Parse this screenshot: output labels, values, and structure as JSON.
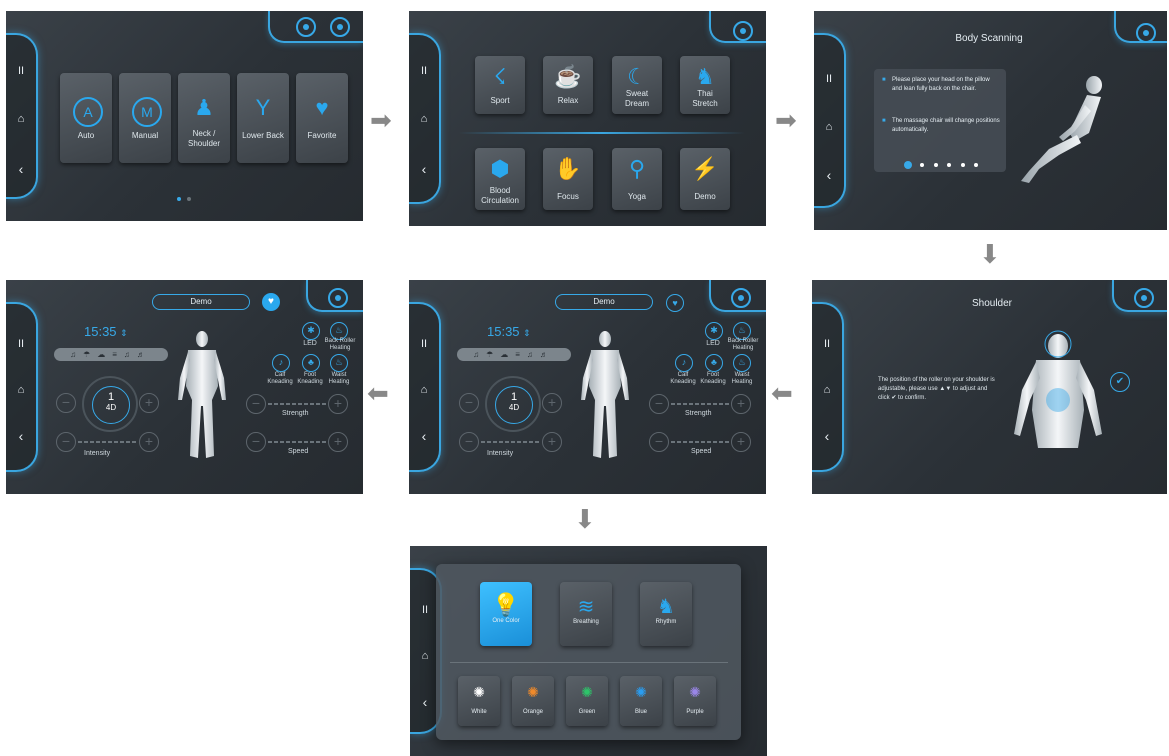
{
  "screen1": {
    "tiles": [
      {
        "glyph": "A",
        "label": "Auto"
      },
      {
        "glyph": "M",
        "label": "Manual"
      },
      {
        "glyph": "♟",
        "label": "Neck /\nShoulder"
      },
      {
        "glyph": "Y",
        "label": "Lower Back"
      },
      {
        "glyph": "♥",
        "label": "Favorite"
      }
    ]
  },
  "screen2": {
    "tiles": [
      {
        "label": "Sport"
      },
      {
        "label": "Relax"
      },
      {
        "label": "Sweat\nDream"
      },
      {
        "label": "Thai\nStretch"
      },
      {
        "label": "Blood\nCirculation"
      },
      {
        "label": "Focus"
      },
      {
        "label": "Yoga"
      },
      {
        "label": "Demo"
      }
    ]
  },
  "screen3": {
    "title": "Body Scanning",
    "bullets": [
      "Please place your head on the pillow and lean fully back on the chair.",
      "The massage chair will change positions automatically."
    ]
  },
  "screen6": {
    "title": "Shoulder",
    "text": "The position of the roller on your shoulder is adjustable, please use ▲▼ to adjust and click ✔ to confirm."
  },
  "screen4": {
    "mode": "Demo",
    "time": "15:35",
    "dial_value": "1",
    "dial_mode": "4D",
    "labels": {
      "intensity": "Intensity",
      "strength": "Strength",
      "speed": "Speed"
    },
    "options": [
      "LED",
      "Back Roller\nHeating",
      "Calf\nKneading",
      "Foot\nKneading",
      "Waist\nHeating"
    ]
  },
  "screen5": {
    "mode": "Demo",
    "time": "15:35",
    "dial_value": "1",
    "dial_mode": "4D",
    "labels": {
      "intensity": "Intensity",
      "strength": "Strength",
      "speed": "Speed"
    },
    "options": [
      "LED",
      "Back Roller\nHeating",
      "Calf\nKneading",
      "Foot\nKneading",
      "Waist\nHeating"
    ]
  },
  "screen7": {
    "modes": [
      "One Color",
      "Breathing",
      "Rhythm"
    ],
    "colors": [
      {
        "label": "White",
        "hex": "#ffffff"
      },
      {
        "label": "Orange",
        "hex": "#f08a2a"
      },
      {
        "label": "Green",
        "hex": "#2ec46a"
      },
      {
        "label": "Blue",
        "hex": "#2a9df0"
      },
      {
        "label": "Purple",
        "hex": "#9a86e8"
      }
    ]
  },
  "colors": {
    "accent": "#37a9e8",
    "background": "#2e343a"
  }
}
